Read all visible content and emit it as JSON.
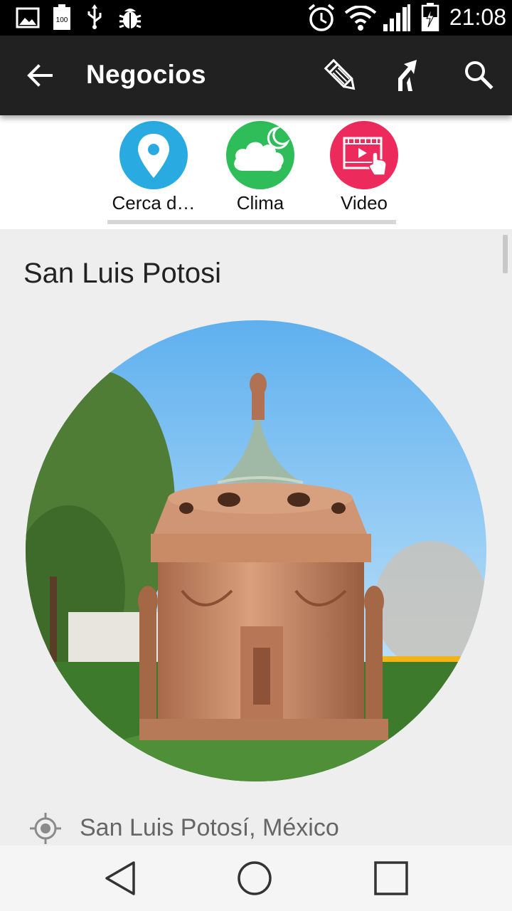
{
  "status_bar": {
    "time": "21:08",
    "left_icons": [
      "image-icon",
      "battery-100-icon",
      "usb-icon",
      "android-debug-icon"
    ],
    "right_icons": [
      "alarm-icon",
      "wifi-icon",
      "signal-icon",
      "battery-charging-icon"
    ]
  },
  "app_bar": {
    "title": "Negocios",
    "actions": [
      "edit-icon",
      "directions-icon",
      "search-icon"
    ]
  },
  "tabs": [
    {
      "label": "Cerca d…",
      "icon": "location-pin-icon",
      "color": "#29abe2"
    },
    {
      "label": "Clima",
      "icon": "weather-cloud-moon-icon",
      "color": "#2ebd59"
    },
    {
      "label": "Video",
      "icon": "video-play-icon",
      "color": "#ec2a5b"
    }
  ],
  "place": {
    "title": "San Luis Potosi",
    "location": "San Luis Potosí, México"
  },
  "nav": {
    "buttons": [
      "back-nav-icon",
      "home-nav-icon",
      "recents-nav-icon"
    ]
  }
}
